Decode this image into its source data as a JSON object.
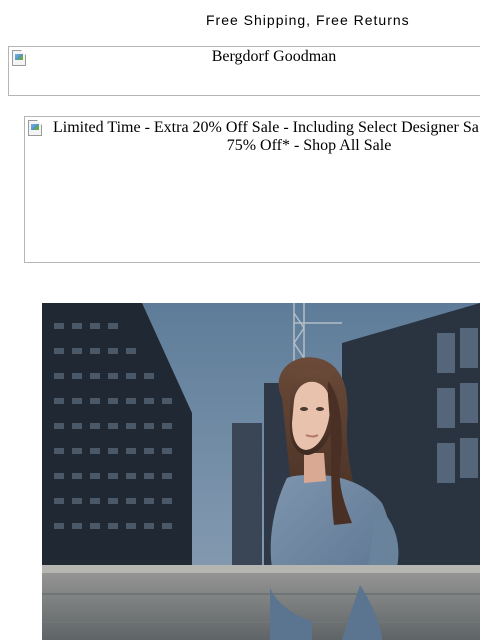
{
  "header": {
    "shipping_link": "Free Shipping, Free Returns"
  },
  "logo": {
    "alt_text": "Bergdorf Goodman",
    "icon": "broken-image-icon"
  },
  "promo_banner": {
    "alt_text_line1": "Limited Time - Extra 20% Off Sale - Including Select Designer Sa",
    "alt_text_line2": "75% Off* - Shop All Sale",
    "icon": "broken-image-icon"
  },
  "hero": {
    "icon": "hero-photo",
    "colors": {
      "sky": "#6f8aa4",
      "building": "#27313d",
      "top": "#6f88a3",
      "hair": "#5a3b2c",
      "skin": "#e5bba6",
      "railing": "#8f9092"
    }
  }
}
